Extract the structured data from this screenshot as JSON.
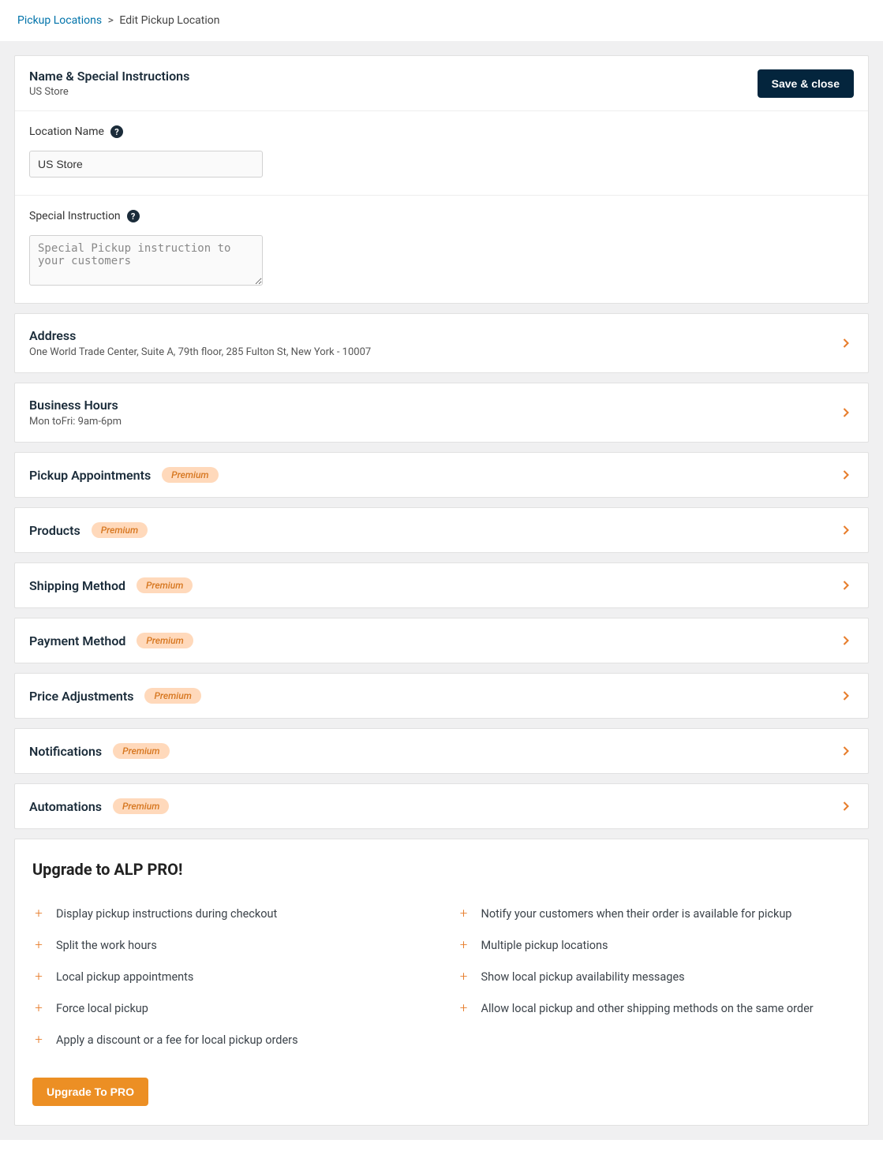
{
  "breadcrumb": {
    "root": "Pickup Locations",
    "sep": ">",
    "current": "Edit Pickup Location"
  },
  "header": {
    "title": "Name & Special Instructions",
    "sub": "US Store",
    "save_btn": "Save & close"
  },
  "form": {
    "location_name_label": "Location Name",
    "location_name_value": "US Store",
    "special_instruction_label": "Special Instruction",
    "special_instruction_placeholder": "Special Pickup instruction to your customers"
  },
  "sections": [
    {
      "title": "Address",
      "sub": "One World Trade Center, Suite A, 79th floor, 285 Fulton St, New York - 10007",
      "premium": false
    },
    {
      "title": "Business Hours",
      "sub": "Mon toFri: 9am-6pm",
      "premium": false
    },
    {
      "title": "Pickup Appointments",
      "sub": "",
      "premium": true
    },
    {
      "title": "Products",
      "sub": "",
      "premium": true
    },
    {
      "title": "Shipping Method",
      "sub": "",
      "premium": true
    },
    {
      "title": "Payment Method",
      "sub": "",
      "premium": true
    },
    {
      "title": "Price Adjustments",
      "sub": "",
      "premium": true
    },
    {
      "title": "Notifications",
      "sub": "",
      "premium": true
    },
    {
      "title": "Automations",
      "sub": "",
      "premium": true
    }
  ],
  "badges": {
    "premium": "Premium"
  },
  "upgrade": {
    "title": "Upgrade to ALP PRO!",
    "btn": "Upgrade To PRO",
    "features_left": [
      "Display pickup instructions during checkout",
      "Split the work hours",
      "Local pickup appointments",
      "Force local pickup",
      "Apply a discount or a fee for local pickup orders"
    ],
    "features_right": [
      "Notify your customers when their order is available for pickup",
      "Multiple pickup locations",
      "Show local pickup availability messages",
      "Allow local pickup and other shipping methods on the same order"
    ]
  }
}
